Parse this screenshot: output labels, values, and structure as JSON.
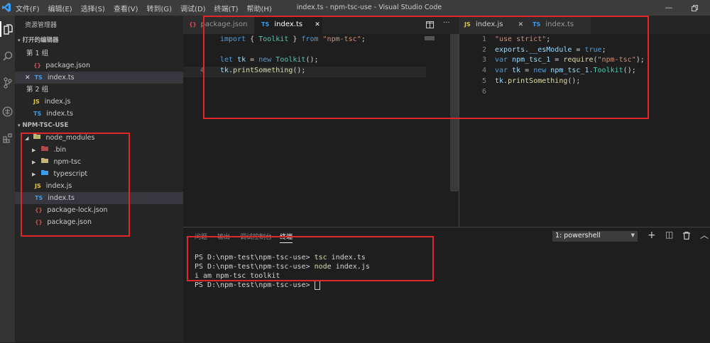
{
  "title_bar": {
    "menu": [
      "文件(F)",
      "编辑(E)",
      "选择(S)",
      "查看(V)",
      "转到(G)",
      "调试(D)",
      "终端(T)",
      "帮助(H)"
    ],
    "window_title": "index.ts - npm-tsc-use - Visual Studio Code",
    "restore_icon": "restore-icon"
  },
  "activity_bar": [
    "explorer-icon",
    "search-icon",
    "source-control-icon",
    "debug-icon",
    "extensions-icon"
  ],
  "sidebar": {
    "title": "资源管理器",
    "open_editors": {
      "header": "打开的编辑器",
      "group1": "第 1 组",
      "group1_items": [
        {
          "badge": "{}",
          "label": "package.json"
        },
        {
          "close": "✕",
          "badge": "TS",
          "label": "index.ts"
        }
      ],
      "group2": "第 2 组",
      "group2_items": [
        {
          "badge": "JS",
          "label": "index.js"
        },
        {
          "badge": "TS",
          "label": "index.ts"
        }
      ]
    },
    "project": {
      "header": "NPM-TSC-USE",
      "items": [
        {
          "label": "node_modules"
        },
        {
          "label": ".bin"
        },
        {
          "label": "npm-tsc"
        },
        {
          "label": "typescript"
        },
        {
          "badge": "JS",
          "label": "index.js"
        },
        {
          "badge": "TS",
          "label": "index.ts"
        },
        {
          "badge": "{}",
          "label": "package-lock.json"
        },
        {
          "badge": "{}",
          "label": "package.json"
        }
      ]
    }
  },
  "editor_left": {
    "tabs": [
      {
        "badge": "{}",
        "label": "package.json"
      },
      {
        "badge": "TS",
        "label": "index.ts",
        "close": "✕"
      }
    ],
    "split_icon": "split-editor-icon",
    "more_icon": "···",
    "line_numbers": [
      "4"
    ],
    "lines": [
      {
        "t": [
          [
            "kw",
            "import "
          ],
          [
            "pl",
            "{ "
          ],
          [
            "cls",
            "Toolkit"
          ],
          [
            "pl",
            " } "
          ],
          [
            "kw",
            "from "
          ],
          [
            "str",
            "\"npm-tsc\""
          ],
          [
            "pl",
            ";"
          ]
        ]
      },
      {
        "t": []
      },
      {
        "t": [
          [
            "kw",
            "let "
          ],
          [
            "var",
            "tk"
          ],
          [
            "pl",
            " = "
          ],
          [
            "kw",
            "new "
          ],
          [
            "cls",
            "Toolkit"
          ],
          [
            "pl",
            "();"
          ]
        ]
      },
      {
        "t": [
          [
            "var",
            "tk"
          ],
          [
            "pl",
            "."
          ],
          [
            "fn",
            "printSomething"
          ],
          [
            "pl",
            "();"
          ]
        ]
      }
    ]
  },
  "editor_right": {
    "tabs": [
      {
        "badge": "JS",
        "label": "index.js",
        "close": "✕"
      },
      {
        "badge": "TS",
        "label": "index.ts"
      }
    ],
    "line_numbers": [
      "1",
      "2",
      "3",
      "4",
      "5",
      "6"
    ],
    "lines": [
      {
        "t": [
          [
            "str",
            "\"use strict\""
          ],
          [
            "pl",
            ";"
          ]
        ]
      },
      {
        "t": [
          [
            "var",
            "exports"
          ],
          [
            "pl",
            "."
          ],
          [
            "var",
            "__esModule"
          ],
          [
            "pl",
            " = "
          ],
          [
            "kw",
            "true"
          ],
          [
            "pl",
            ";"
          ]
        ]
      },
      {
        "t": [
          [
            "kw",
            "var "
          ],
          [
            "var",
            "npm_tsc_1"
          ],
          [
            "pl",
            " = "
          ],
          [
            "fn",
            "require"
          ],
          [
            "pl",
            "("
          ],
          [
            "str",
            "\"npm-tsc\""
          ],
          [
            "pl",
            ");"
          ]
        ]
      },
      {
        "t": [
          [
            "kw",
            "var "
          ],
          [
            "var",
            "tk"
          ],
          [
            "pl",
            " = "
          ],
          [
            "kw",
            "new "
          ],
          [
            "var",
            "npm_tsc_1"
          ],
          [
            "pl",
            "."
          ],
          [
            "cls",
            "Toolkit"
          ],
          [
            "pl",
            "();"
          ]
        ]
      },
      {
        "t": [
          [
            "var",
            "tk"
          ],
          [
            "pl",
            "."
          ],
          [
            "fn",
            "printSomething"
          ],
          [
            "pl",
            "();"
          ]
        ]
      },
      {
        "t": []
      }
    ]
  },
  "panel": {
    "tabs": [
      "问题",
      "输出",
      "调试控制台",
      "终端"
    ],
    "terminal_select": "1: powershell",
    "terminal_lines": [
      [
        [
          "pl",
          "PS D:\\npm-test\\npm-tsc-use> "
        ],
        [
          "fn",
          "tsc"
        ],
        [
          "pl",
          " index.ts"
        ]
      ],
      [
        [
          "pl",
          "PS D:\\npm-test\\npm-tsc-use> "
        ],
        [
          "fn",
          "node"
        ],
        [
          "pl",
          " index.js"
        ]
      ],
      [
        [
          "pl",
          "i am npm-tsc toolkit"
        ]
      ],
      [
        [
          "pl",
          "PS D:\\npm-test\\npm-tsc-use> "
        ]
      ]
    ],
    "actions": [
      "add-terminal-icon",
      "split-terminal-icon",
      "trash-icon",
      "maximize-panel-icon"
    ],
    "add_glyph": "+",
    "split_glyph": "◫",
    "up_glyph": "︿"
  },
  "accent_colors": {
    "annotation_red": "#e0262a",
    "ts_blue": "#3b9df1",
    "js_yellow": "#e5c743",
    "json_red": "#cc4e4e"
  }
}
